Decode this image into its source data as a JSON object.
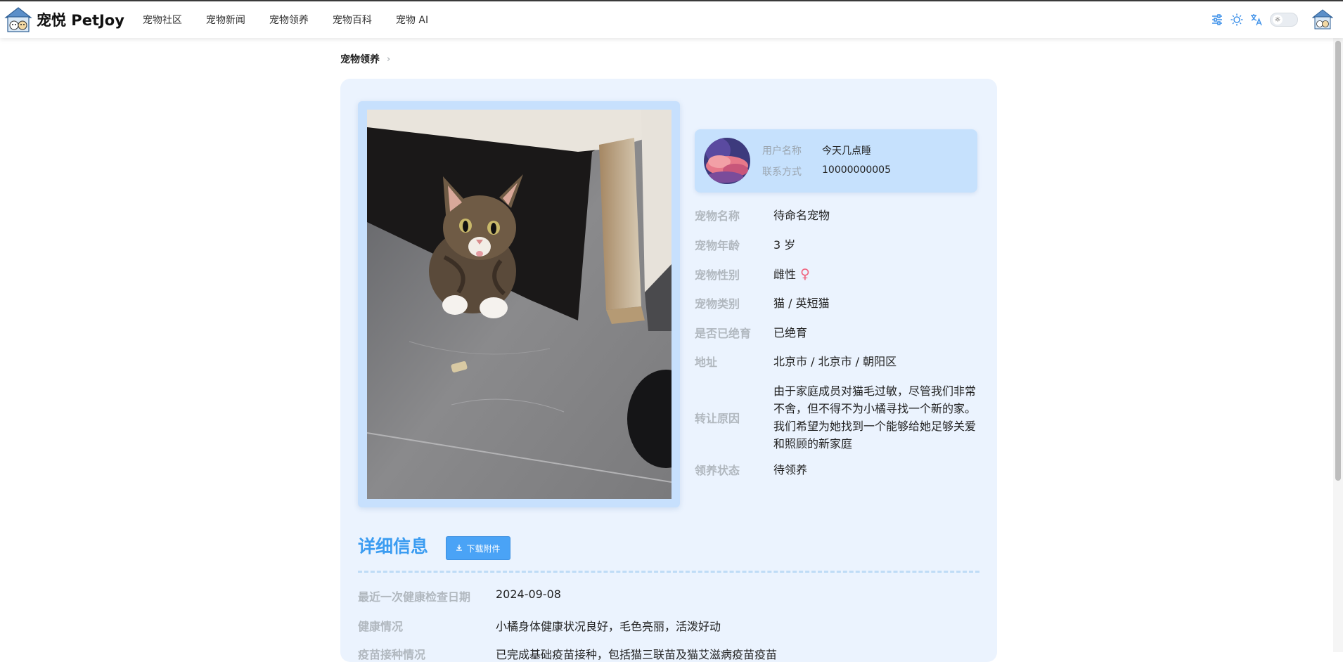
{
  "app": {
    "brand_name": "宠悦 PetJoy"
  },
  "nav": {
    "items": [
      {
        "label": "宠物社区"
      },
      {
        "label": "宠物新闻"
      },
      {
        "label": "宠物领养"
      },
      {
        "label": "宠物百科"
      },
      {
        "label": "宠物 AI"
      }
    ]
  },
  "tools": {
    "icons": [
      "sliders-icon",
      "sun-icon",
      "translate-icon",
      "theme-toggle",
      "user-avatar"
    ]
  },
  "breadcrumb": {
    "current": "宠物领养"
  },
  "owner": {
    "name_label": "用户名称",
    "name_value": "今天几点睡",
    "contact_label": "联系方式",
    "contact_value": "10000000005"
  },
  "pet": {
    "fields": [
      {
        "label": "宠物名称",
        "value": "待命名宠物"
      },
      {
        "label": "宠物年龄",
        "value": "3 岁"
      },
      {
        "label": "宠物性别",
        "value": "雌性",
        "symbol": "♀"
      },
      {
        "label": "宠物类别",
        "value": "猫 / 英短猫"
      },
      {
        "label": "是否已绝育",
        "value": "已绝育"
      },
      {
        "label": "地址",
        "value": "北京市 / 北京市 / 朝阳区"
      },
      {
        "label": "转让原因",
        "value": "由于家庭成员对猫毛过敏，尽管我们非常不舍，但不得不为小橘寻找一个新的家。我们希望为她找到一个能够给她足够关爱和照顾的新家庭"
      },
      {
        "label": "领养状态",
        "value": "待领养"
      }
    ]
  },
  "details": {
    "title": "详细信息",
    "download_label": "下载附件",
    "rows": [
      {
        "label": "最近一次健康检查日期",
        "value": "2024-09-08"
      },
      {
        "label": "健康情况",
        "value": "小橘身体健康状况良好，毛色亮丽，活泼好动"
      },
      {
        "label": "疫苗接种情况",
        "value": "已完成基础疫苗接种，包括猫三联苗及猫艾滋病疫苗疫苗"
      }
    ]
  },
  "colors": {
    "accent": "#3b9cf1",
    "card_bg": "#ebf3fe",
    "female": "#f0637e"
  }
}
